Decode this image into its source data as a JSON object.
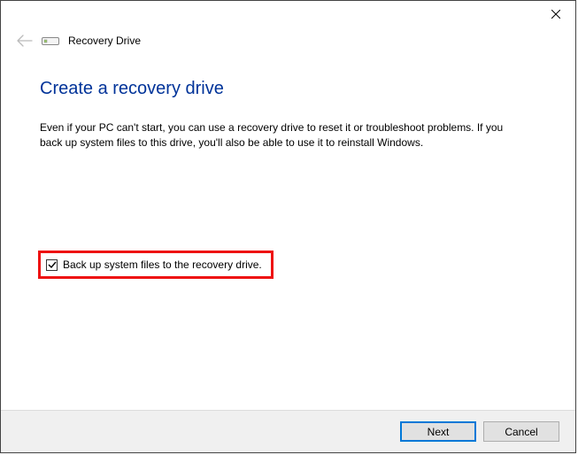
{
  "header": {
    "app_title": "Recovery Drive"
  },
  "main": {
    "heading": "Create a recovery drive",
    "description": "Even if your PC can't start, you can use a recovery drive to reset it or troubleshoot problems. If you back up system files to this drive, you'll also be able to use it to reinstall Windows."
  },
  "option": {
    "backup_label": "Back up system files to the recovery drive.",
    "backup_checked": true
  },
  "footer": {
    "next_label": "Next",
    "cancel_label": "Cancel"
  }
}
